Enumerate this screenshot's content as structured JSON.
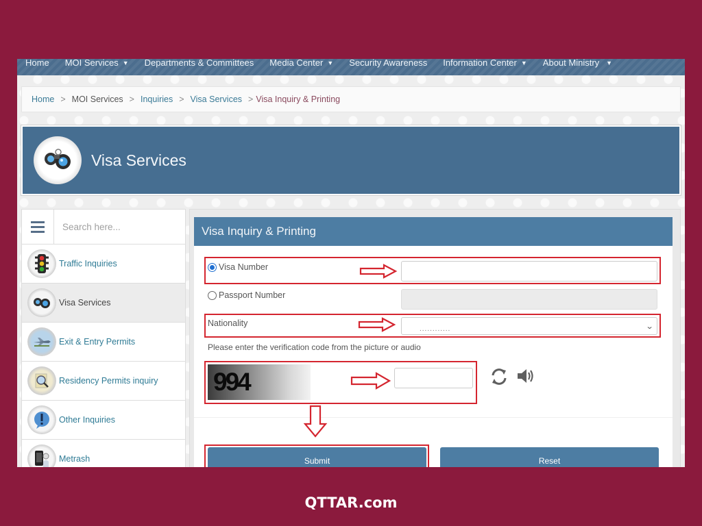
{
  "nav": {
    "items": [
      {
        "label": "Home",
        "has_dropdown": false
      },
      {
        "label": "MOI Services",
        "has_dropdown": true
      },
      {
        "label": "Departments & Committees",
        "has_dropdown": false
      },
      {
        "label": "Media Center",
        "has_dropdown": true
      },
      {
        "label": "Security Awareness",
        "has_dropdown": false
      },
      {
        "label": "Information Center",
        "has_dropdown": true
      },
      {
        "label": "About Ministry",
        "has_dropdown": true
      }
    ],
    "caret": "▼"
  },
  "breadcrumb": {
    "items": [
      "Home",
      "MOI Services",
      "Inquiries",
      "Visa Services",
      "Visa Inquiry & Printing"
    ],
    "separator": ">"
  },
  "banner": {
    "title": "Visa Services",
    "icon": "binoculars-icon"
  },
  "sidebar": {
    "search_placeholder": "Search here...",
    "menu_icon": "hamburger-icon",
    "items": [
      {
        "label": "Traffic Inquiries",
        "icon": "traffic-light-icon",
        "active": false
      },
      {
        "label": "Visa Services",
        "icon": "binoculars-icon",
        "active": true
      },
      {
        "label": "Exit & Entry Permits",
        "icon": "airplane-icon",
        "active": false
      },
      {
        "label": "Residency Permits inquiry",
        "icon": "magnifier-document-icon",
        "active": false
      },
      {
        "label": "Other Inquiries",
        "icon": "exclamation-icon",
        "active": false
      },
      {
        "label": "Metrash",
        "icon": "mobile-phone-icon",
        "active": false
      }
    ]
  },
  "form": {
    "title": "Visa Inquiry & Printing",
    "visa_number": {
      "label": "Visa Number",
      "selected": true,
      "value": ""
    },
    "passport_number": {
      "label": "Passport Number",
      "selected": false,
      "value": ""
    },
    "nationality": {
      "label": "Nationality",
      "selected_value": "............"
    },
    "captcha_hint": "Please enter the verification code from the picture or audio",
    "captcha_code": "994",
    "captcha_value": "",
    "submit_label": "Submit",
    "reset_label": "Reset"
  },
  "colors": {
    "frame": "#8b1a3d",
    "nav": "#4b6d8e",
    "header": "#4d7da3",
    "highlight": "#d4252f"
  },
  "footer": {
    "brand": "QTTAR.com"
  }
}
